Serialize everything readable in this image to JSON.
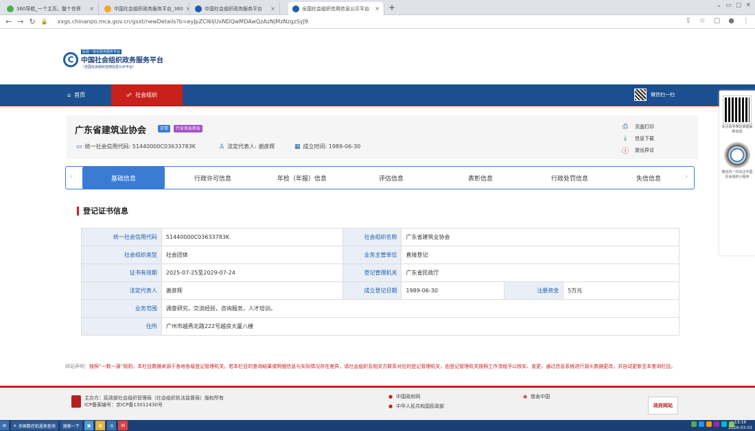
{
  "browser": {
    "tabs": [
      {
        "title": "360导航_一个主页，整个世界",
        "color": "#4caf50"
      },
      {
        "title": "中国社会组织政务服务平台_360",
        "color": "#f5a623"
      },
      {
        "title": "中国社会组织政务服务平台",
        "color": "#1c5ea8"
      },
      {
        "title": "全国社会组织信用信息公示平台",
        "color": "#1c5ea8"
      }
    ],
    "new_tab": "+",
    "url": "xxgs.chinanpo.mca.gov.cn/gsxt/newDetails?b=eyJpZCI6IjUxNDQwMDAwQzAzNjMzNzgzSyJ9"
  },
  "header": {
    "logo_small": "民政一体化政务服务平台",
    "logo_title": "中国社会组织政务服务平台",
    "logo_sub": "（全国社会组织信用信息公示平台）"
  },
  "nav": {
    "home": "首页",
    "org": "社会组织",
    "wechat": "微信扫一扫"
  },
  "org": {
    "name": "广东省建筑业协会",
    "badge1": "正常",
    "badge2": "行业协会商会",
    "credit_code_label": "统一社会信用代码: 51440000C03633783K",
    "legal_rep_label": "法定代表人: 谢彦辉",
    "founded_label": "成立时间: 1989-06-30"
  },
  "actions": {
    "print": "页面打印",
    "download": "信息下载",
    "objection": "提出异议"
  },
  "tabs": [
    "基础信息",
    "行政许可信息",
    "年检（年报）信息",
    "评估信息",
    "表彰信息",
    "行政处罚信息",
    "失信信息"
  ],
  "section_title": "登记证书信息",
  "table": {
    "credit_code_l": "统一社会信用代码",
    "credit_code_v": "51440000C03633783K",
    "org_name_l": "社会组织名称",
    "org_name_v": "广东省建筑业协会",
    "type_l": "社会组织类型",
    "type_v": "社会团体",
    "supervisor_l": "业务主管单位",
    "supervisor_v": "直接登记",
    "validity_l": "证书有效期",
    "validity_v": "2025-07-25至2029-07-24",
    "authority_l": "登记管理机关",
    "authority_v": "广东省民政厅",
    "legal_l": "法定代表人",
    "legal_v": "谢彦辉",
    "reg_date_l": "成立登记日期",
    "reg_date_v": "1989-06-30",
    "capital_l": "注册资金",
    "capital_v": "5万元",
    "scope_l": "业务范围",
    "scope_v": "调查研究，交流经验，咨询服务，人才培训。",
    "address_l": "住所",
    "address_v": "广州市越秀北路222号越良大厦八楼"
  },
  "footer": {
    "notice_label": "网站声明：",
    "notice_text": "按照“一数一源”规则，本栏目数据来源于各地各级登记管理机关。若本栏目的查询结果或明细信息与实际情况存在差异，请社会组织及相关方联系对应的登记管理机关，由登记管理机关按照工作流程予以核实、变更，通过信息系统进行源头数据更改，并自动更新至本查询栏目。",
    "host": "主办方：民政部社会组织管理局（社会组织执法监督局）版权所有",
    "icp": "ICP备案编号：京ICP备13012430号",
    "gov_link": "中国政府网",
    "mca_link": "中华人民共和国民政部",
    "charity": "慈善中国",
    "gov_badge": "政府网站"
  },
  "side": {
    "qr1_text": "关注政务微信掌握最新动态",
    "qr2_text": "微信扫一扫关注中国社会组织小程序"
  },
  "taskbar": {
    "item1": "多国数控机遣表查询",
    "item2": "搜索一下",
    "time": "13:16",
    "date": "2026-03-03"
  }
}
